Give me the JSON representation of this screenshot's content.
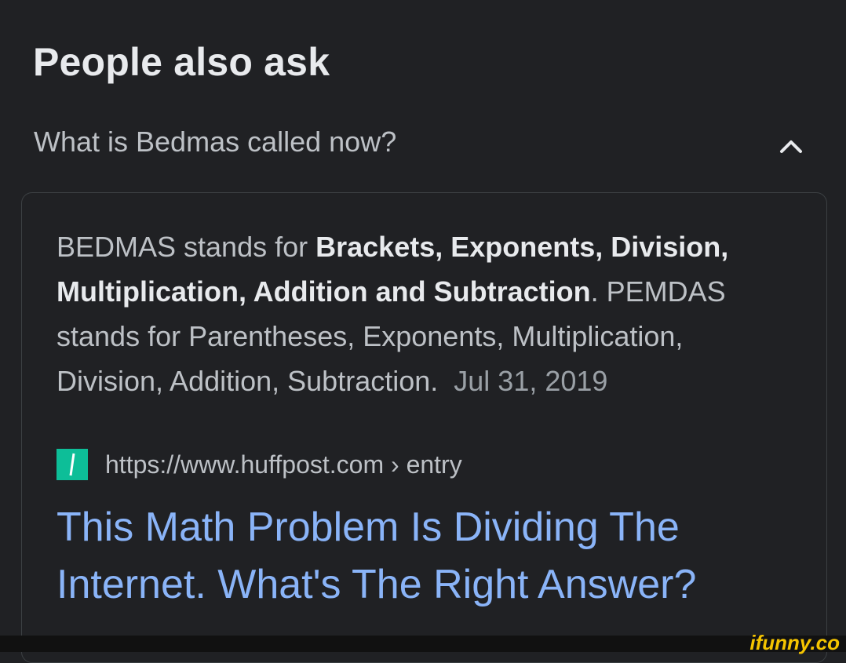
{
  "header": {
    "title": "People also ask"
  },
  "question": {
    "text": "What is Bedmas called now?",
    "toggle_icon": "chevron-up-icon"
  },
  "answer": {
    "intro": "BEDMAS stands for ",
    "bold_part": "Brackets, Exponents, Division, Multiplication, Addition and Subtraction",
    "rest": ". PEMDAS stands for Parentheses, Exponents, Multiplication, Division, Addition, Subtraction.",
    "date": "Jul 31, 2019"
  },
  "source": {
    "url": "https://www.huffpost.com › entry",
    "favicon": "huffpost-favicon",
    "favicon_color": "#0dbe98"
  },
  "result": {
    "title": "This Math Problem Is Dividing The Internet. What's The Right Answer?"
  },
  "watermark": {
    "text": "ifunny.co"
  },
  "colors": {
    "background": "#202124",
    "link": "#8ab4f8",
    "text": "#bdc1c6",
    "heading": "#e8eaed"
  }
}
